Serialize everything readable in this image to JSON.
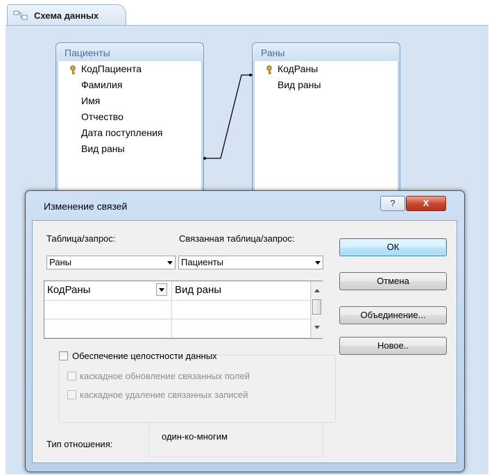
{
  "tab": {
    "title": "Схема данных",
    "icon": "relationships-icon"
  },
  "tables": [
    {
      "name": "Пациенты",
      "fields": [
        {
          "label": "КодПациента",
          "key": true
        },
        {
          "label": "Фамилия",
          "key": false
        },
        {
          "label": "Имя",
          "key": false
        },
        {
          "label": "Отчество",
          "key": false
        },
        {
          "label": "Дата поступления",
          "key": false
        },
        {
          "label": "Вид раны",
          "key": false
        }
      ]
    },
    {
      "name": "Раны",
      "fields": [
        {
          "label": "КодРаны",
          "key": true
        },
        {
          "label": "Вид раны",
          "key": false
        }
      ]
    }
  ],
  "dialog": {
    "title": "Изменение связей",
    "help_label": "?",
    "close_label": "X",
    "table_label": "Таблица/запрос:",
    "related_label": "Связанная таблица/запрос:",
    "table_value": "Раны",
    "related_value": "Пациенты",
    "grid": [
      [
        "КодРаны",
        "Вид раны"
      ],
      [
        "",
        ""
      ],
      [
        "",
        ""
      ]
    ],
    "integrity_label": "Обеспечение целостности данных",
    "cascade_update_label": "каскадное обновление связанных полей",
    "cascade_delete_label": "каскадное удаление связанных записей",
    "reltype_label": "Тип отношения:",
    "reltype_value": "один-ко-многим",
    "buttons": {
      "ok": "ОК",
      "cancel": "Отмена",
      "join": "Объединение...",
      "new": "Новое.."
    }
  }
}
